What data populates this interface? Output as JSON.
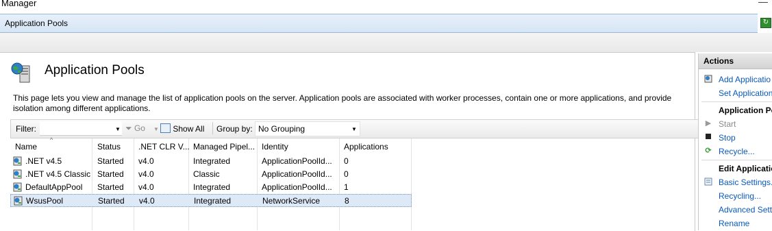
{
  "window": {
    "title": "Manager"
  },
  "address": {
    "breadcrumb": "Application Pools"
  },
  "page": {
    "title": "Application Pools",
    "description": "This page lets you view and manage the list of application pools on the server. Application pools are associated with worker processes, contain one or more applications, and provide isolation among different applications."
  },
  "toolbar": {
    "filter_label": "Filter:",
    "filter_value": "",
    "go_label": "Go",
    "show_all_label": "Show All",
    "group_by_label": "Group by:",
    "group_by_value": "No Grouping"
  },
  "table": {
    "columns": [
      "Name",
      "Status",
      ".NET CLR V...",
      "Managed Pipel...",
      "Identity",
      "Applications"
    ],
    "rows": [
      {
        "name": ".NET v4.5",
        "status": "Started",
        "clr": "v4.0",
        "pipeline": "Integrated",
        "identity": "ApplicationPoolId...",
        "apps": "0"
      },
      {
        "name": ".NET v4.5 Classic",
        "status": "Started",
        "clr": "v4.0",
        "pipeline": "Classic",
        "identity": "ApplicationPoolId...",
        "apps": "0"
      },
      {
        "name": "DefaultAppPool",
        "status": "Started",
        "clr": "v4.0",
        "pipeline": "Integrated",
        "identity": "ApplicationPoolId...",
        "apps": "1"
      },
      {
        "name": "WsusPool",
        "status": "Started",
        "clr": "v4.0",
        "pipeline": "Integrated",
        "identity": "NetworkService",
        "apps": "8"
      }
    ],
    "selected_row": 3
  },
  "actions": {
    "header": "Actions",
    "add_app_pool": "Add Applicatio",
    "set_defaults": "Set Application",
    "section_pool": "Application Po",
    "start": "Start",
    "stop": "Stop",
    "recycle": "Recycle...",
    "section_edit": "Edit Applicatio",
    "basic_settings": "Basic Settings...",
    "recycling": "Recycling...",
    "advanced_settings": "Advanced Setti",
    "rename": "Rename"
  },
  "colors": {
    "link": "#0b58b8",
    "selection": "#dde9f6",
    "address_bar": "#dce9f6"
  }
}
